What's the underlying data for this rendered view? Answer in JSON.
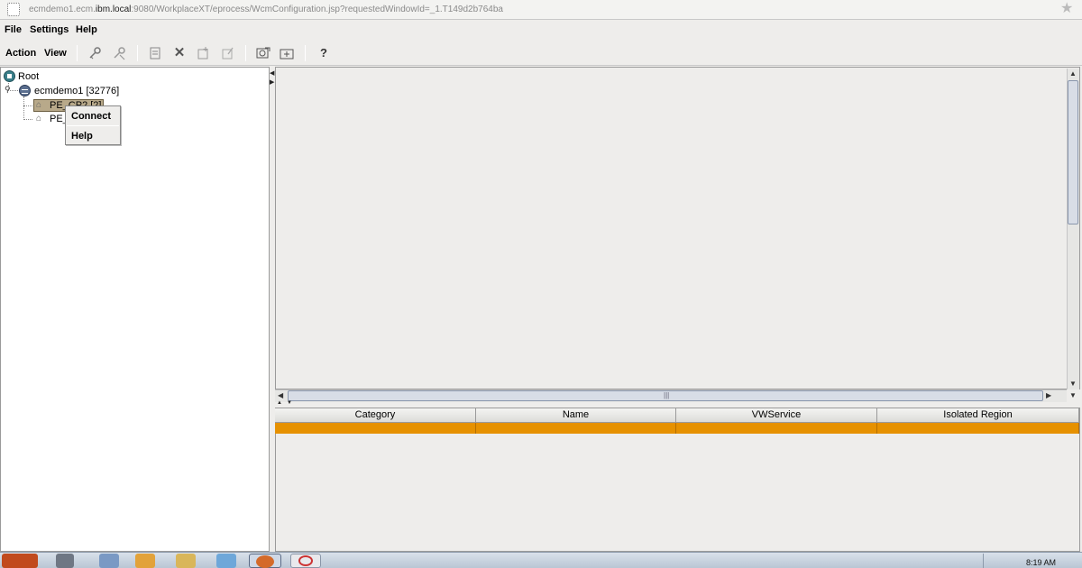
{
  "browser": {
    "url_prefix": "ecmdemo1.ecm.",
    "url_host": "ibm.local",
    "url_rest": ":9080/WorkplaceXT/eprocess/WcmConfiguration.jsp?requestedWindowId=_1.T149d2b764ba",
    "icons": [
      "page-icon",
      "bookmark-star-icon"
    ]
  },
  "menubar": {
    "file": "File",
    "settings": "Settings",
    "help": "Help"
  },
  "toolbar": {
    "action": "Action",
    "view": "View",
    "icons": [
      "connect-key-icon",
      "disconnect-key-icon",
      "properties-icon",
      "delete-icon",
      "new-icon",
      "edit-icon",
      "commit-icon",
      "open-folder-icon"
    ],
    "help_glyph": "?"
  },
  "tree": {
    "root": "Root",
    "server": "ecmdemo1 [32776]",
    "node1": "PE_CP2 [2]",
    "node2": "PE_"
  },
  "context_menu": {
    "connect": "Connect",
    "help": "Help"
  },
  "table": {
    "columns": [
      "Category",
      "Name",
      "VWService",
      "Isolated Region"
    ],
    "selected_row_color": "#e69100"
  },
  "taskbar": {
    "clock": "8:19 AM"
  }
}
